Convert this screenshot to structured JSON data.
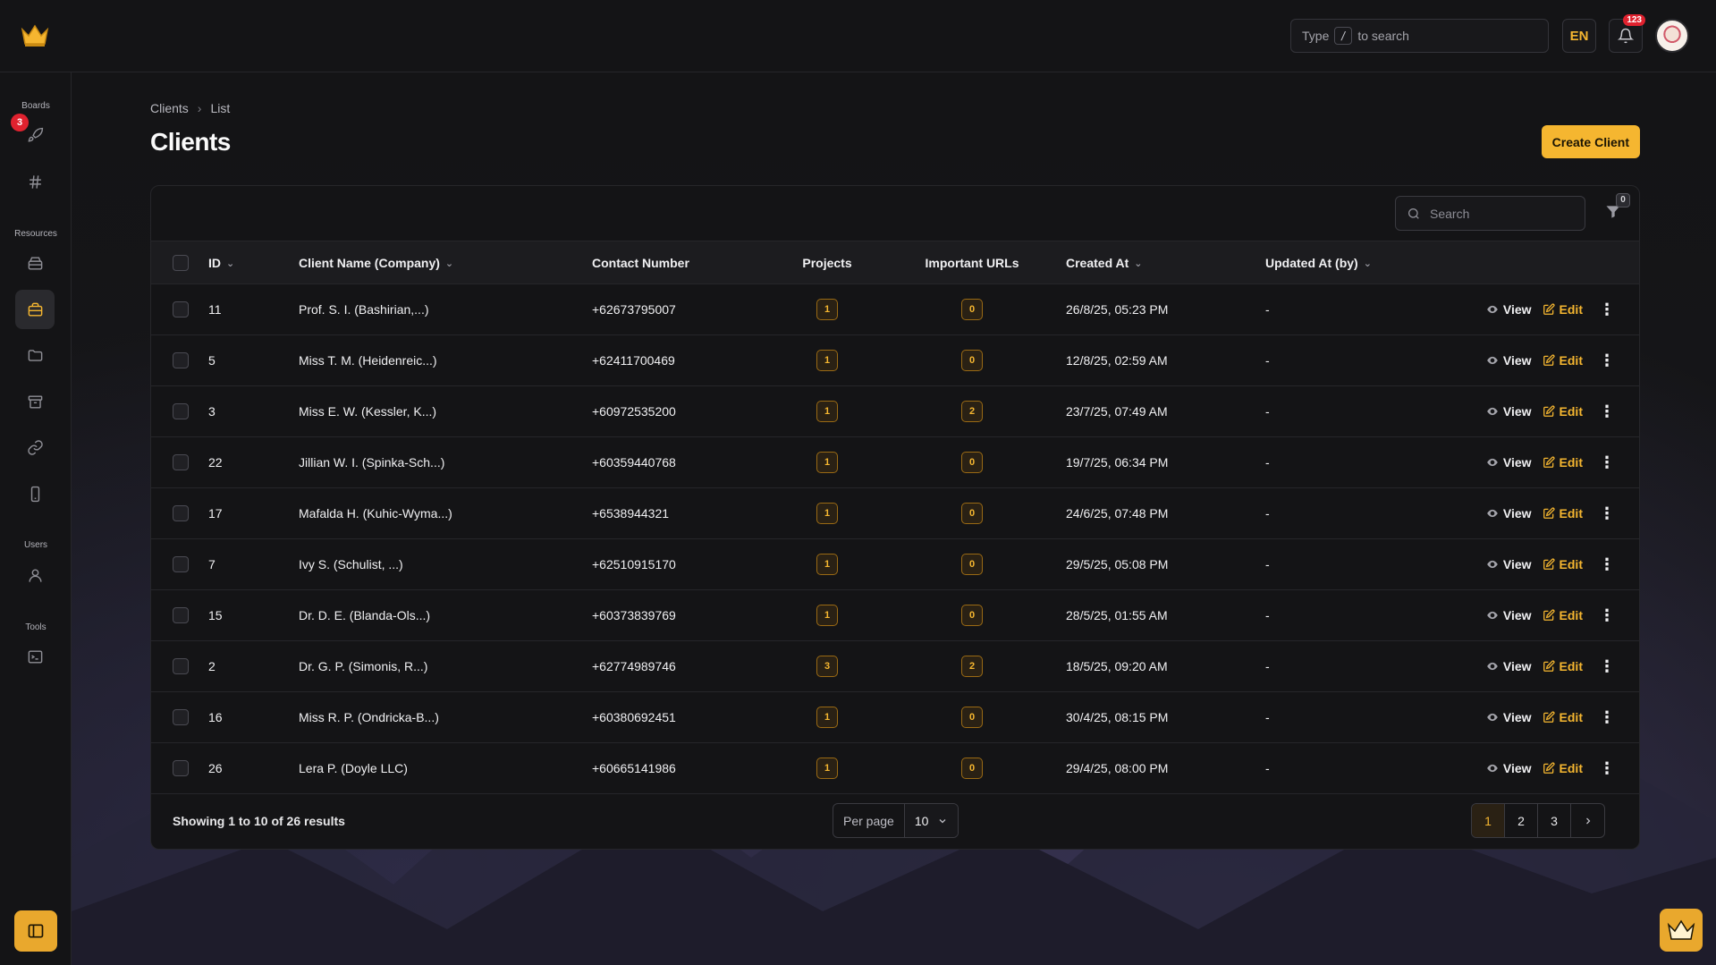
{
  "topbar": {
    "search_prefix": "Type",
    "search_key": "/",
    "search_suffix": "to search",
    "language": "EN",
    "notifications_count": "123"
  },
  "sidebar": {
    "sections": {
      "boards": "Boards",
      "resources": "Resources",
      "users": "Users",
      "tools": "Tools"
    },
    "boards_badge": "3",
    "icons": [
      "rocket-icon",
      "hash-icon",
      "archive-box-icon",
      "briefcase-icon",
      "folder-icon",
      "package-icon",
      "link-icon",
      "mobile-icon",
      "user-icon",
      "terminal-icon"
    ]
  },
  "breadcrumb": {
    "root": "Clients",
    "current": "List"
  },
  "page": {
    "title": "Clients",
    "create_label": "Create Client"
  },
  "table": {
    "search_placeholder": "Search",
    "filter_count": "0",
    "columns": {
      "id": "ID",
      "name": "Client Name (Company)",
      "contact": "Contact Number",
      "projects": "Projects",
      "urls": "Important URLs",
      "created": "Created At",
      "updated": "Updated At (by)"
    },
    "rows": [
      {
        "id": "11",
        "name": "Prof. S. I. (Bashirian,...)",
        "contact": "+62673795007",
        "projects": "1",
        "urls": "0",
        "created": "26/8/25, 05:23 PM",
        "updated": "-"
      },
      {
        "id": "5",
        "name": "Miss T. M. (Heidenreic...)",
        "contact": "+62411700469",
        "projects": "1",
        "urls": "0",
        "created": "12/8/25, 02:59 AM",
        "updated": "-"
      },
      {
        "id": "3",
        "name": "Miss E. W. (Kessler, K...)",
        "contact": "+60972535200",
        "projects": "1",
        "urls": "2",
        "created": "23/7/25, 07:49 AM",
        "updated": "-"
      },
      {
        "id": "22",
        "name": "Jillian W. I. (Spinka-Sch...)",
        "contact": "+60359440768",
        "projects": "1",
        "urls": "0",
        "created": "19/7/25, 06:34 PM",
        "updated": "-"
      },
      {
        "id": "17",
        "name": "Mafalda H. (Kuhic-Wyma...)",
        "contact": "+6538944321",
        "projects": "1",
        "urls": "0",
        "created": "24/6/25, 07:48 PM",
        "updated": "-"
      },
      {
        "id": "7",
        "name": "Ivy S. (Schulist, ...)",
        "contact": "+62510915170",
        "projects": "1",
        "urls": "0",
        "created": "29/5/25, 05:08 PM",
        "updated": "-"
      },
      {
        "id": "15",
        "name": "Dr. D. E. (Blanda-Ols...)",
        "contact": "+60373839769",
        "projects": "1",
        "urls": "0",
        "created": "28/5/25, 01:55 AM",
        "updated": "-"
      },
      {
        "id": "2",
        "name": "Dr. G. P. (Simonis, R...)",
        "contact": "+62774989746",
        "projects": "3",
        "urls": "2",
        "created": "18/5/25, 09:20 AM",
        "updated": "-"
      },
      {
        "id": "16",
        "name": "Miss R. P. (Ondricka-B...)",
        "contact": "+60380692451",
        "projects": "1",
        "urls": "0",
        "created": "30/4/25, 08:15 PM",
        "updated": "-"
      },
      {
        "id": "26",
        "name": "Lera P. (Doyle LLC)",
        "contact": "+60665141986",
        "projects": "1",
        "urls": "0",
        "created": "29/4/25, 08:00 PM",
        "updated": "-"
      }
    ],
    "view_label": "View",
    "edit_label": "Edit"
  },
  "footer": {
    "showing": "Showing 1 to 10 of 26 results",
    "per_page_label": "Per page",
    "per_page_value": "10",
    "pages": [
      "1",
      "2",
      "3"
    ],
    "current_page": "1"
  },
  "colors": {
    "accent": "#f5b630",
    "badge_red": "#e0222f",
    "background": "#141416"
  }
}
